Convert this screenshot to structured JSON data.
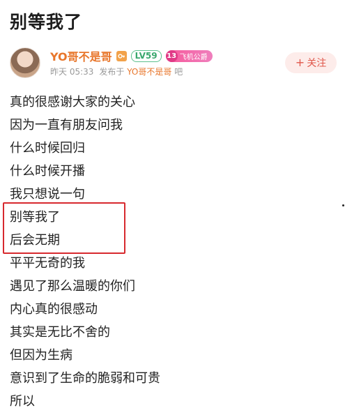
{
  "post": {
    "title": "别等我了",
    "author": {
      "name": "YO哥不是哥",
      "level": "LV59",
      "fan_badge_number": "13",
      "fan_badge_name": "飞机公爵"
    },
    "meta": {
      "time": "昨天 05:33",
      "published_in_prefix": "发布于",
      "forum": "YO哥不是哥",
      "forum_suffix": "吧"
    },
    "follow_label": "关注",
    "lines": [
      "真的很感谢大家的关心",
      "因为一直有朋友问我",
      "什么时候回归",
      "什么时候开播",
      "我只想说一句",
      "别等我了",
      "后会无期",
      "平平无奇的我",
      "遇见了那么温暖的你们",
      "内心真的很感动",
      "其实是无比不舍的",
      "但因为生病",
      "意识到了生命的脆弱和可贵",
      "所以"
    ]
  },
  "colors": {
    "accent": "#e8762b",
    "follow": "#e0574b",
    "highlight": "#d7292e",
    "level": "#3aa76d"
  },
  "icons": {
    "author_badge": "key-icon",
    "follow": "plus-icon"
  }
}
